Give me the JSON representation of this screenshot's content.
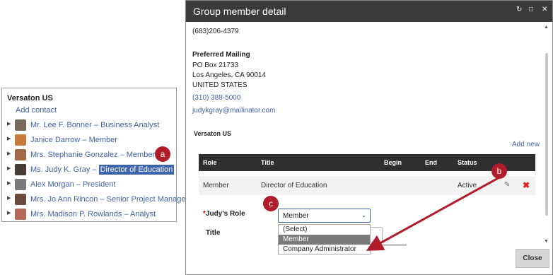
{
  "left_panel": {
    "org_name": "Versaton US",
    "add_contact": "Add contact",
    "contacts": [
      {
        "name": "Mr. Lee F. Bonner",
        "role": "Business Analyst",
        "photo_color": "#7a6a5c"
      },
      {
        "name": "Janice Darrow",
        "role": "Member",
        "photo_color": "#c87a3c"
      },
      {
        "name": "Mrs. Stephanie Gonzalez",
        "role": "Member",
        "photo_color": "#a06a4a"
      },
      {
        "name": "Ms. Judy K. Gray",
        "role": "Director of Education",
        "photo_color": "#4a3a34"
      },
      {
        "name": "Alex Morgan",
        "role": "President",
        "photo_color": "#7a7a7a"
      },
      {
        "name": "Mrs. Jo Ann Rincon",
        "role": "Senior Project Manager",
        "photo_color": "#6a4c3c"
      },
      {
        "name": "Mrs. Madison P. Rowlands",
        "role": "Analyst",
        "photo_color": "#b86a5a"
      }
    ],
    "separator": "–"
  },
  "dialog": {
    "title": "Group member detail",
    "phone_top": "(683)206-4379",
    "preferred_mailing_label": "Preferred Mailing",
    "address_line1": "PO Box 21733",
    "address_line2": "Los Angeles, CA 90014",
    "address_line3": "UNITED STATES",
    "phone": "(310) 388-5000",
    "email": "judykgray@mailinator.com",
    "org_label": "Versaton US",
    "add_new": "Add new",
    "grid": {
      "headers": [
        "Role",
        "Title",
        "Begin",
        "End",
        "Status"
      ],
      "row": {
        "role": "Member",
        "title": "Director of Education",
        "begin": "",
        "end": "",
        "status": "Active"
      }
    },
    "role_field": {
      "required_mark": "*",
      "label": "Judy's Role",
      "value": "Member",
      "options": [
        "(Select)",
        "Member",
        "Company Administrator"
      ]
    },
    "title_label": "Title",
    "close": "Close"
  },
  "annotations": {
    "a": "a",
    "b": "b",
    "c": "c",
    "color": "#b01c2a"
  }
}
